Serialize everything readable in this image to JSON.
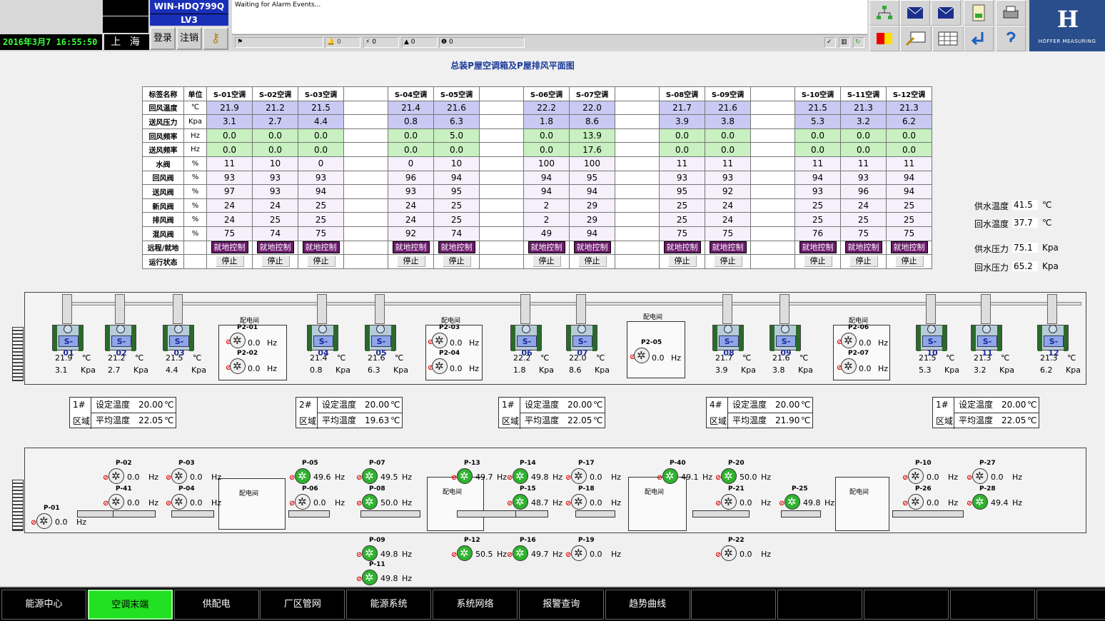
{
  "header": {
    "host": "WIN-HDQ799Q",
    "level": "LV3",
    "datetime": "2016年3月7  16:55:50",
    "city": "上 海",
    "login": "登录",
    "logout": "注销",
    "alarm_text": "Waiting for Alarm Events...",
    "counts": [
      "0",
      "0",
      "0",
      "0"
    ],
    "logo_mark": "H",
    "logo_text": "HOFFER MEASURING"
  },
  "title": "总装P屋空调箱及P屋排风平面图",
  "table": {
    "col_label": "标签名称",
    "col_unit": "单位",
    "units": [
      "S-01空调",
      "S-02空调",
      "S-03空调",
      "",
      "S-04空调",
      "S-05空调",
      "",
      "S-06空调",
      "S-07空调",
      "",
      "S-08空调",
      "S-09空调",
      "",
      "S-10空调",
      "S-11空调",
      "S-12空调"
    ],
    "rows": [
      {
        "label": "回风温度",
        "unit": "℃",
        "cls": "blue",
        "vals": [
          "21.9",
          "21.2",
          "21.5",
          "",
          "21.4",
          "21.6",
          "",
          "22.2",
          "22.0",
          "",
          "21.7",
          "21.6",
          "",
          "21.5",
          "21.3",
          "21.3"
        ]
      },
      {
        "label": "送风压力",
        "unit": "Kpa",
        "cls": "blue",
        "vals": [
          "3.1",
          "2.7",
          "4.4",
          "",
          "0.8",
          "6.3",
          "",
          "1.8",
          "8.6",
          "",
          "3.9",
          "3.8",
          "",
          "5.3",
          "3.2",
          "6.2"
        ]
      },
      {
        "label": "回风频率",
        "unit": "Hz",
        "cls": "green",
        "vals": [
          "0.0",
          "0.0",
          "0.0",
          "",
          "0.0",
          "5.0",
          "",
          "0.0",
          "13.9",
          "",
          "0.0",
          "0.0",
          "",
          "0.0",
          "0.0",
          "0.0"
        ]
      },
      {
        "label": "送风频率",
        "unit": "Hz",
        "cls": "green",
        "vals": [
          "0.0",
          "0.0",
          "0.0",
          "",
          "0.0",
          "0.0",
          "",
          "0.0",
          "17.6",
          "",
          "0.0",
          "0.0",
          "",
          "0.0",
          "0.0",
          "0.0"
        ]
      },
      {
        "label": "水阀",
        "unit": "%",
        "cls": "lav",
        "vals": [
          "11",
          "10",
          "0",
          "",
          "0",
          "10",
          "",
          "100",
          "100",
          "",
          "11",
          "11",
          "",
          "11",
          "11",
          "11"
        ]
      },
      {
        "label": "回风阀",
        "unit": "%",
        "cls": "lav",
        "vals": [
          "93",
          "93",
          "93",
          "",
          "96",
          "94",
          "",
          "94",
          "95",
          "",
          "93",
          "93",
          "",
          "94",
          "93",
          "94"
        ]
      },
      {
        "label": "送风阀",
        "unit": "%",
        "cls": "lav",
        "vals": [
          "97",
          "93",
          "94",
          "",
          "93",
          "95",
          "",
          "94",
          "94",
          "",
          "95",
          "92",
          "",
          "93",
          "96",
          "94"
        ]
      },
      {
        "label": "新风阀",
        "unit": "%",
        "cls": "lav",
        "vals": [
          "24",
          "24",
          "25",
          "",
          "24",
          "25",
          "",
          "2",
          "29",
          "",
          "25",
          "24",
          "",
          "25",
          "24",
          "25"
        ]
      },
      {
        "label": "排风阀",
        "unit": "%",
        "cls": "lav",
        "vals": [
          "24",
          "25",
          "25",
          "",
          "24",
          "25",
          "",
          "2",
          "29",
          "",
          "25",
          "24",
          "",
          "25",
          "25",
          "25"
        ]
      },
      {
        "label": "混风阀",
        "unit": "%",
        "cls": "lav",
        "vals": [
          "75",
          "74",
          "75",
          "",
          "92",
          "74",
          "",
          "49",
          "94",
          "",
          "75",
          "75",
          "",
          "76",
          "75",
          "75"
        ]
      }
    ],
    "ctl_label": "远程/就地",
    "ctl": [
      "就地控制",
      "就地控制",
      "就地控制",
      "",
      "就地控制",
      "就地控制",
      "",
      "就地控制",
      "就地控制",
      "",
      "就地控制",
      "就地控制",
      "",
      "就地控制",
      "就地控制",
      "就地控制"
    ],
    "st_label": "运行状态",
    "st": [
      "停止",
      "停止",
      "停止",
      "",
      "停止",
      "停止",
      "",
      "停止",
      "停止",
      "",
      "停止",
      "停止",
      "",
      "停止",
      "停止",
      "停止"
    ]
  },
  "water": [
    {
      "label": "供水温度",
      "value": "41.5",
      "unit": "℃"
    },
    {
      "label": "回水温度",
      "value": "37.7",
      "unit": "℃"
    },
    {
      "label": "供水压力",
      "value": "75.1",
      "unit": "Kpa"
    },
    {
      "label": "回水压力",
      "value": "65.2",
      "unit": "Kpa"
    }
  ],
  "ahu": [
    {
      "id": "S-01",
      "t": "21.9",
      "p": "3.1"
    },
    {
      "id": "S-02",
      "t": "21.2",
      "p": "2.7"
    },
    {
      "id": "S-03",
      "t": "21.5",
      "p": "4.4"
    },
    {
      "id": "S-04",
      "t": "21.4",
      "p": "0.8"
    },
    {
      "id": "S-05",
      "t": "21.6",
      "p": "6.3"
    },
    {
      "id": "S-06",
      "t": "22.2",
      "p": "1.8"
    },
    {
      "id": "S-07",
      "t": "22.0",
      "p": "8.6"
    },
    {
      "id": "S-08",
      "t": "21.7",
      "p": "3.9"
    },
    {
      "id": "S-09",
      "t": "21.6",
      "p": "3.8"
    },
    {
      "id": "S-10",
      "t": "21.5",
      "p": "5.3"
    },
    {
      "id": "S-11",
      "t": "21.3",
      "p": "3.2"
    },
    {
      "id": "S-12",
      "t": "21.3",
      "p": "6.2"
    }
  ],
  "units": {
    "c": "℃",
    "kpa": "Kpa",
    "hz": "Hz"
  },
  "room_label": "配电间",
  "top_fans": [
    {
      "id": "P2-01",
      "v": "0.0",
      "on": false
    },
    {
      "id": "P2-02",
      "v": "0.0",
      "on": false
    },
    {
      "id": "P2-03",
      "v": "0.0",
      "on": false
    },
    {
      "id": "P2-04",
      "v": "0.0",
      "on": false
    },
    {
      "id": "P2-05",
      "v": "0.0",
      "on": false
    },
    {
      "id": "P2-06",
      "v": "0.0",
      "on": false
    },
    {
      "id": "P2-07",
      "v": "0.0",
      "on": false
    }
  ],
  "zones": [
    {
      "num": "1#",
      "area": "区域",
      "set_label": "设定温度",
      "set": "20.00",
      "avg_label": "平均温度",
      "avg": "22.05",
      "unit": "℃"
    },
    {
      "num": "2#",
      "area": "区域",
      "set_label": "设定温度",
      "set": "20.00",
      "avg_label": "平均温度",
      "avg": "19.63",
      "unit": "℃"
    },
    {
      "num": "1#",
      "area": "区域",
      "set_label": "设定温度",
      "set": "20.00",
      "avg_label": "平均温度",
      "avg": "22.05",
      "unit": "℃"
    },
    {
      "num": "4#",
      "area": "区域",
      "set_label": "设定温度",
      "set": "20.00",
      "avg_label": "平均温度",
      "avg": "21.90",
      "unit": "℃"
    },
    {
      "num": "1#",
      "area": "区域",
      "set_label": "设定温度",
      "set": "20.00",
      "avg_label": "平均温度",
      "avg": "22.05",
      "unit": "℃"
    }
  ],
  "exhaust": [
    {
      "id": "P-02",
      "v": "0.0",
      "on": false
    },
    {
      "id": "P-41",
      "v": "0.0",
      "on": false
    },
    {
      "id": "P-03",
      "v": "0.0",
      "on": false
    },
    {
      "id": "P-04",
      "v": "0.0",
      "on": false
    },
    {
      "id": "P-01",
      "v": "0.0",
      "on": false
    },
    {
      "id": "P-05",
      "v": "49.6",
      "on": true
    },
    {
      "id": "P-06",
      "v": "0.0",
      "on": false
    },
    {
      "id": "P-07",
      "v": "49.5",
      "on": true
    },
    {
      "id": "P-08",
      "v": "50.0",
      "on": true
    },
    {
      "id": "P-09",
      "v": "49.8",
      "on": true
    },
    {
      "id": "P-11",
      "v": "49.8",
      "on": true
    },
    {
      "id": "P-13",
      "v": "49.7",
      "on": true
    },
    {
      "id": "P-12",
      "v": "50.5",
      "on": true
    },
    {
      "id": "P-14",
      "v": "49.8",
      "on": true
    },
    {
      "id": "P-15",
      "v": "48.7",
      "on": true
    },
    {
      "id": "P-16",
      "v": "49.7",
      "on": true
    },
    {
      "id": "P-17",
      "v": "0.0",
      "on": false
    },
    {
      "id": "P-18",
      "v": "0.0",
      "on": false
    },
    {
      "id": "P-19",
      "v": "0.0",
      "on": false
    },
    {
      "id": "P-40",
      "v": "49.1",
      "on": true
    },
    {
      "id": "P-20",
      "v": "50.0",
      "on": true
    },
    {
      "id": "P-21",
      "v": "0.0",
      "on": false
    },
    {
      "id": "P-22",
      "v": "0.0",
      "on": false
    },
    {
      "id": "P-25",
      "v": "49.8",
      "on": true
    },
    {
      "id": "P-10",
      "v": "0.0",
      "on": false
    },
    {
      "id": "P-26",
      "v": "0.0",
      "on": false
    },
    {
      "id": "P-27",
      "v": "0.0",
      "on": false
    },
    {
      "id": "P-28",
      "v": "49.4",
      "on": true
    }
  ],
  "nav": [
    "能源中心",
    "空调末端",
    "供配电",
    "厂区管网",
    "能源系统",
    "系统网络",
    "报警查询",
    "趋势曲线",
    "",
    "",
    "",
    "",
    ""
  ],
  "nav_active": 1,
  "colors": {
    "accent": "#1a2fb8",
    "ctl": "#6b1a6b",
    "on": "#2fb32f",
    "nav_active": "#22e022"
  }
}
